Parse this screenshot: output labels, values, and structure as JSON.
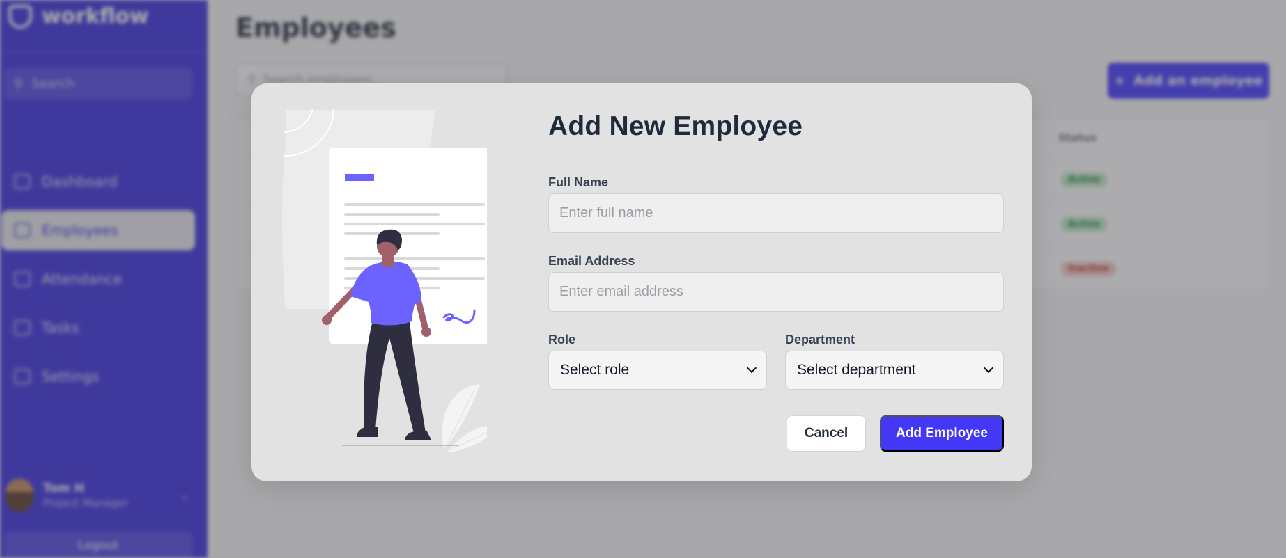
{
  "sidebar": {
    "brand": "workflow",
    "search_placeholder": "Search",
    "items": [
      {
        "label": "Dashboard"
      },
      {
        "label": "Employees"
      },
      {
        "label": "Attendance"
      },
      {
        "label": "Tasks"
      },
      {
        "label": "Settings"
      }
    ],
    "user": {
      "name": "Tom H",
      "role": "Project Manager"
    },
    "logout_label": "Logout"
  },
  "main": {
    "title": "Employees",
    "search_placeholder": "Search employees...",
    "add_button_label": "Add an employee",
    "table_status_header": "Status",
    "statuses": [
      "Active",
      "Active",
      "Inactive"
    ]
  },
  "modal": {
    "title": "Add New Employee",
    "full_name": {
      "label": "Full Name",
      "placeholder": "Enter full name",
      "value": ""
    },
    "email": {
      "label": "Email Address",
      "placeholder": "Enter email address",
      "value": ""
    },
    "role": {
      "label": "Role",
      "selected": "Select role"
    },
    "department": {
      "label": "Department",
      "selected": "Select department"
    },
    "cancel_label": "Cancel",
    "submit_label": "Add Employee"
  },
  "colors": {
    "brand": "#3b2fe0",
    "primary_button": "#4338f5",
    "modal_bg": "#e2e2e3",
    "illustration_accent": "#6c63ff"
  }
}
